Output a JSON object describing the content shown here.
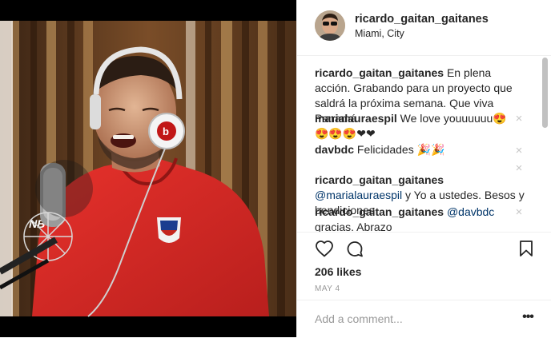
{
  "header": {
    "username": "ricardo_gaitan_gaitanes",
    "location": "Miami, City"
  },
  "comments": [
    {
      "user": "ricardo_gaitan_gaitanes",
      "text": "En plena acción. Grabando para un proyecto que saldrá la próxima semana. Que viva Panamá"
    },
    {
      "user": "marialauraespil",
      "text": "We love youuuuuu😍 😍😍😍❤❤"
    },
    {
      "user": "davbdc",
      "text": "Felicidades 🎉🎉"
    },
    {
      "user": "ricardo_gaitan_gaitanes",
      "mention": "@marialauraespil",
      "text": "y Yo a ustedes. Besos y bendiciones"
    },
    {
      "user": "ricardo_gaitan_gaitanes",
      "mention": "@davbdc",
      "text": "gracias. Abrazo"
    }
  ],
  "delete_icon": "×",
  "likes": "206 likes",
  "date": "MAY 4",
  "add_comment": {
    "placeholder": "Add a comment..."
  },
  "more_icon": "•••",
  "icons": [
    "heart-icon",
    "comment-icon",
    "bookmark-icon",
    "more-options-icon",
    "close-icon"
  ],
  "colors": {
    "text": "#262626",
    "muted": "#999999",
    "link": "#003569",
    "shirt": "#d42a27",
    "border": "#efefef"
  }
}
